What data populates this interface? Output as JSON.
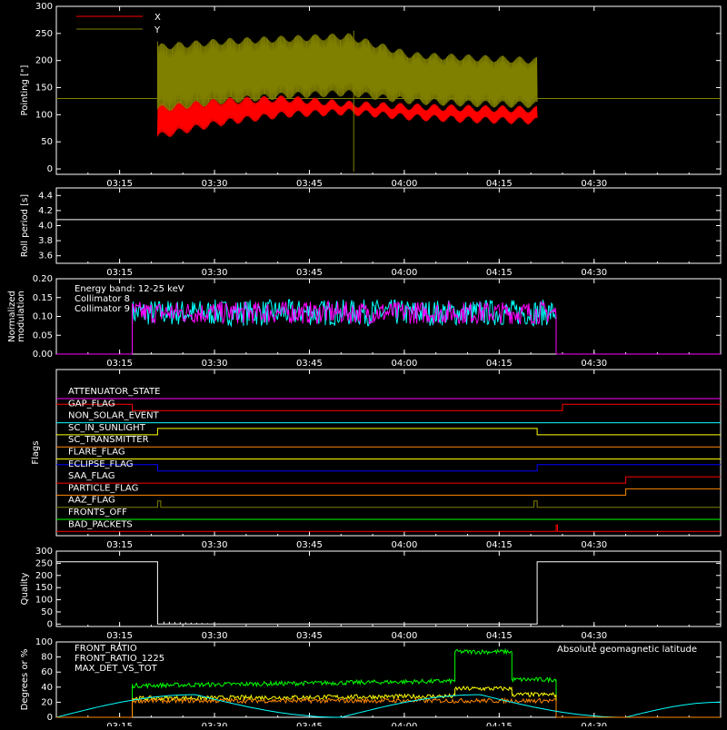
{
  "colors": {
    "background": "#000000",
    "axis": "#ffffff",
    "red": "#ff0000",
    "olive": "#808000",
    "cyan": "#00ffff",
    "magenta": "#ff00ff",
    "white": "#ffffff",
    "green": "#00ff00",
    "orange": "#ff8800",
    "yellow": "#ffff00",
    "blue": "#0000ff"
  },
  "time_axis": {
    "tick_labels": [
      "03:15",
      "03:30",
      "03:45",
      "04:00",
      "04:15",
      "04:30"
    ]
  },
  "chart_data": [
    {
      "id": "pointing",
      "type": "line",
      "ylabel": "Pointing [\"]",
      "ylim": [
        -10,
        300
      ],
      "yticks": [
        0,
        50,
        100,
        150,
        200,
        250,
        300
      ],
      "legend": [
        "X",
        "Y"
      ],
      "legend_position": "top-left",
      "series": [
        {
          "name": "X",
          "color": "#ff0000",
          "t_start": "03:21",
          "t_end": "04:21",
          "low": [
            60,
            85,
            100,
            105,
            95,
            90,
            88
          ],
          "high": [
            115,
            125,
            130,
            120,
            115,
            112,
            110
          ]
        },
        {
          "name": "Y",
          "color": "#808000",
          "t_start": "03:21",
          "t_end": "04:21",
          "low": [
            110,
            125,
            135,
            140,
            125,
            120,
            118
          ],
          "high": [
            225,
            235,
            240,
            245,
            210,
            205,
            200
          ]
        }
      ],
      "reference_line": 130
    },
    {
      "id": "roll_period",
      "type": "line",
      "ylabel": "Roll period [s]",
      "ylim": [
        3.5,
        4.5
      ],
      "yticks": [
        3.6,
        3.8,
        4.0,
        4.2,
        4.4
      ],
      "series": [
        {
          "value": 4.08,
          "color": "#ffffff"
        }
      ]
    },
    {
      "id": "modulation",
      "type": "line",
      "ylabel": "Normalized modulation",
      "ylim": [
        0,
        0.2
      ],
      "yticks": [
        0.0,
        0.05,
        0.1,
        0.15,
        0.2
      ],
      "legend": [
        "Energy band: 12-25 keV",
        "Collimator 8",
        "Collimator 9"
      ],
      "series": [
        {
          "name": "Collimator 8",
          "color": "#00ffff",
          "t_start": "03:17",
          "t_end": "04:24",
          "mean": 0.11,
          "spread": 0.035
        },
        {
          "name": "Collimator 9",
          "color": "#ff00ff",
          "t_start": "03:17",
          "t_end": "04:24",
          "mean": 0.11,
          "spread": 0.03
        }
      ]
    },
    {
      "id": "flags",
      "type": "line",
      "ylabel": "Flags",
      "flags": [
        {
          "name": "ATTENUATOR_STATE",
          "color": "#ff00ff",
          "steps": [
            [
              "03:05",
              0
            ]
          ]
        },
        {
          "name": "GAP_FLAG",
          "color": "#ff0000",
          "steps": [
            [
              "03:05",
              1
            ],
            [
              "03:17",
              0
            ],
            [
              "04:25",
              1
            ]
          ]
        },
        {
          "name": "NON_SOLAR_EVENT",
          "color": "#00ffff",
          "steps": [
            [
              "03:05",
              0
            ]
          ]
        },
        {
          "name": "SC_IN_SUNLIGHT",
          "color": "#ffff00",
          "steps": [
            [
              "03:05",
              0
            ],
            [
              "03:21",
              1
            ],
            [
              "04:21",
              0
            ]
          ]
        },
        {
          "name": "SC_TRANSMITTER",
          "color": "#ff8800",
          "steps": [
            [
              "03:05",
              0
            ]
          ]
        },
        {
          "name": "FLARE_FLAG",
          "color": "#ffff00",
          "steps": [
            [
              "03:05",
              0
            ]
          ]
        },
        {
          "name": "ECLIPSE_FLAG",
          "color": "#0000ff",
          "steps": [
            [
              "03:05",
              1
            ],
            [
              "03:21",
              0
            ],
            [
              "04:21",
              1
            ]
          ]
        },
        {
          "name": "SAA_FLAG",
          "color": "#ff0000",
          "steps": [
            [
              "03:05",
              0
            ],
            [
              "04:35",
              1
            ]
          ]
        },
        {
          "name": "PARTICLE_FLAG",
          "color": "#ff8800",
          "steps": [
            [
              "03:05",
              0
            ],
            [
              "04:35",
              1
            ]
          ]
        },
        {
          "name": "AAZ_FLAG",
          "color": "#808000",
          "steps": [
            [
              "03:05",
              0
            ],
            [
              "03:21",
              1
            ],
            [
              "03:21.5",
              0
            ],
            [
              "04:20.5",
              1
            ],
            [
              "04:21",
              0
            ]
          ]
        },
        {
          "name": "FRONTS_OFF",
          "color": "#00ff00",
          "steps": [
            [
              "03:05",
              0
            ]
          ]
        },
        {
          "name": "BAD_PACKETS",
          "color": "#ff0000",
          "steps": [
            [
              "03:05",
              0
            ],
            [
              "04:24",
              1
            ],
            [
              "04:24.2",
              0
            ]
          ]
        }
      ]
    },
    {
      "id": "quality",
      "type": "line",
      "ylabel": "Quality",
      "ylim": [
        -10,
        300
      ],
      "yticks": [
        0,
        50,
        100,
        150,
        200,
        250,
        300
      ],
      "series": [
        {
          "color": "#ffffff",
          "points": [
            [
              "03:05",
              256
            ],
            [
              "03:21",
              256
            ],
            [
              "03:21",
              0
            ],
            [
              "04:21",
              0
            ],
            [
              "04:21",
              256
            ],
            [
              "04:50",
              256
            ]
          ]
        }
      ]
    },
    {
      "id": "ratios",
      "type": "line",
      "ylabel": "Degrees or %",
      "ylim": [
        0,
        100
      ],
      "yticks": [
        0,
        20,
        40,
        60,
        80,
        100
      ],
      "legend": [
        "FRONT_RATIO",
        "FRONT_RATIO_1225",
        "MAX_DET_VS_TOT"
      ],
      "annotation": "Absolute geomagnetic latitude",
      "series": [
        {
          "name": "FRONT_RATIO_1225",
          "color": "#00ff00",
          "t_start": "03:17",
          "t_end": "04:24",
          "levels": [
            [
              "03:17",
              42
            ],
            [
              "04:08",
              48
            ],
            [
              "04:08",
              87
            ],
            [
              "04:17",
              87
            ],
            [
              "04:17",
              50
            ],
            [
              "04:24",
              50
            ]
          ]
        },
        {
          "name": "FRONT_RATIO",
          "color": "#ffff00",
          "t_start": "03:17",
          "t_end": "04:24",
          "levels": [
            [
              "03:17",
              25
            ],
            [
              "04:08",
              28
            ],
            [
              "04:08",
              38
            ],
            [
              "04:17",
              38
            ],
            [
              "04:17",
              30
            ],
            [
              "04:24",
              30
            ]
          ]
        },
        {
          "name": "MAX_DET_VS_TOT",
          "color": "#ff8800",
          "t_start": "03:17",
          "t_end": "04:24",
          "levels": [
            [
              "03:17",
              22
            ],
            [
              "04:24",
              22
            ]
          ]
        },
        {
          "name": "Absolute geomagnetic latitude",
          "color": "#00ffff",
          "points": [
            [
              "03:05",
              0
            ],
            [
              "03:27",
              30
            ],
            [
              "03:50",
              0
            ],
            [
              "04:12",
              30
            ],
            [
              "04:35",
              0
            ],
            [
              "04:50",
              20
            ]
          ]
        }
      ]
    }
  ]
}
